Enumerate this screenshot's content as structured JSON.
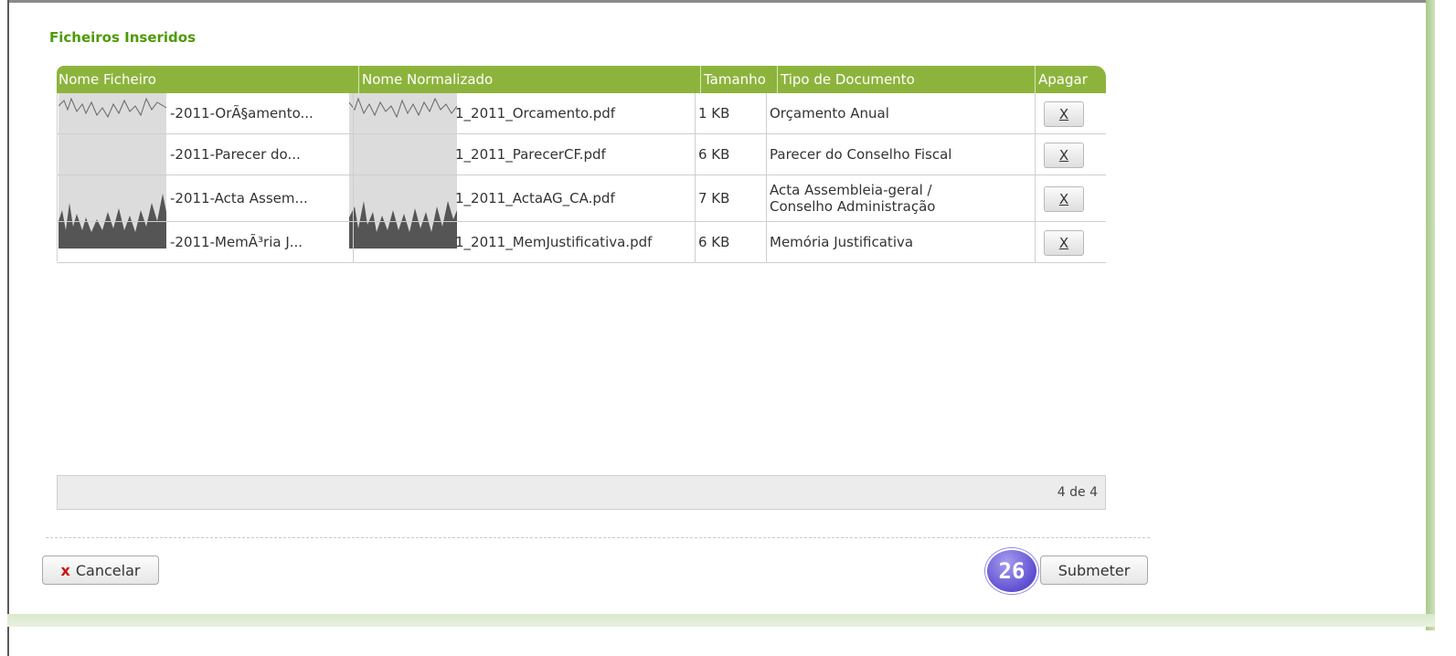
{
  "section": {
    "title": "Ficheiros Inseridos"
  },
  "table": {
    "headers": [
      "Nome Ficheiro",
      "Nome Normalizado",
      "Tamanho",
      "Tipo de Documento",
      "Apagar"
    ],
    "rows": [
      {
        "file_name": "-2011-OrÃ§amento...",
        "normalized": "1_2011_Orcamento.pdf",
        "size": "1 KB",
        "doc_type": "Orçamento Anual",
        "delete": "X"
      },
      {
        "file_name": "-2011-Parecer do...",
        "normalized": "1_2011_ParecerCF.pdf",
        "size": "6 KB",
        "doc_type": "Parecer do Conselho Fiscal",
        "delete": "X"
      },
      {
        "file_name": "-2011-Acta Assem...",
        "normalized": "1_2011_ActaAG_CA.pdf",
        "size": "7 KB",
        "doc_type": "Acta Assembleia-geral / Conselho Administração",
        "delete": "X"
      },
      {
        "file_name": "-2011-MemÃ³ria J...",
        "normalized": "1_2011_MemJustificativa.pdf",
        "size": "6 KB",
        "doc_type": "Memória Justificativa",
        "delete": "X"
      }
    ]
  },
  "pager": {
    "label": "4 de 4"
  },
  "buttons": {
    "cancel": "Cancelar",
    "cancel_icon": "x",
    "submit": "Submeter"
  },
  "step_badge": "26",
  "colors": {
    "accent": "#8cb43c",
    "title": "#4e9a06",
    "cancel_x": "#cc1111",
    "badge": "#5f4fd1"
  }
}
